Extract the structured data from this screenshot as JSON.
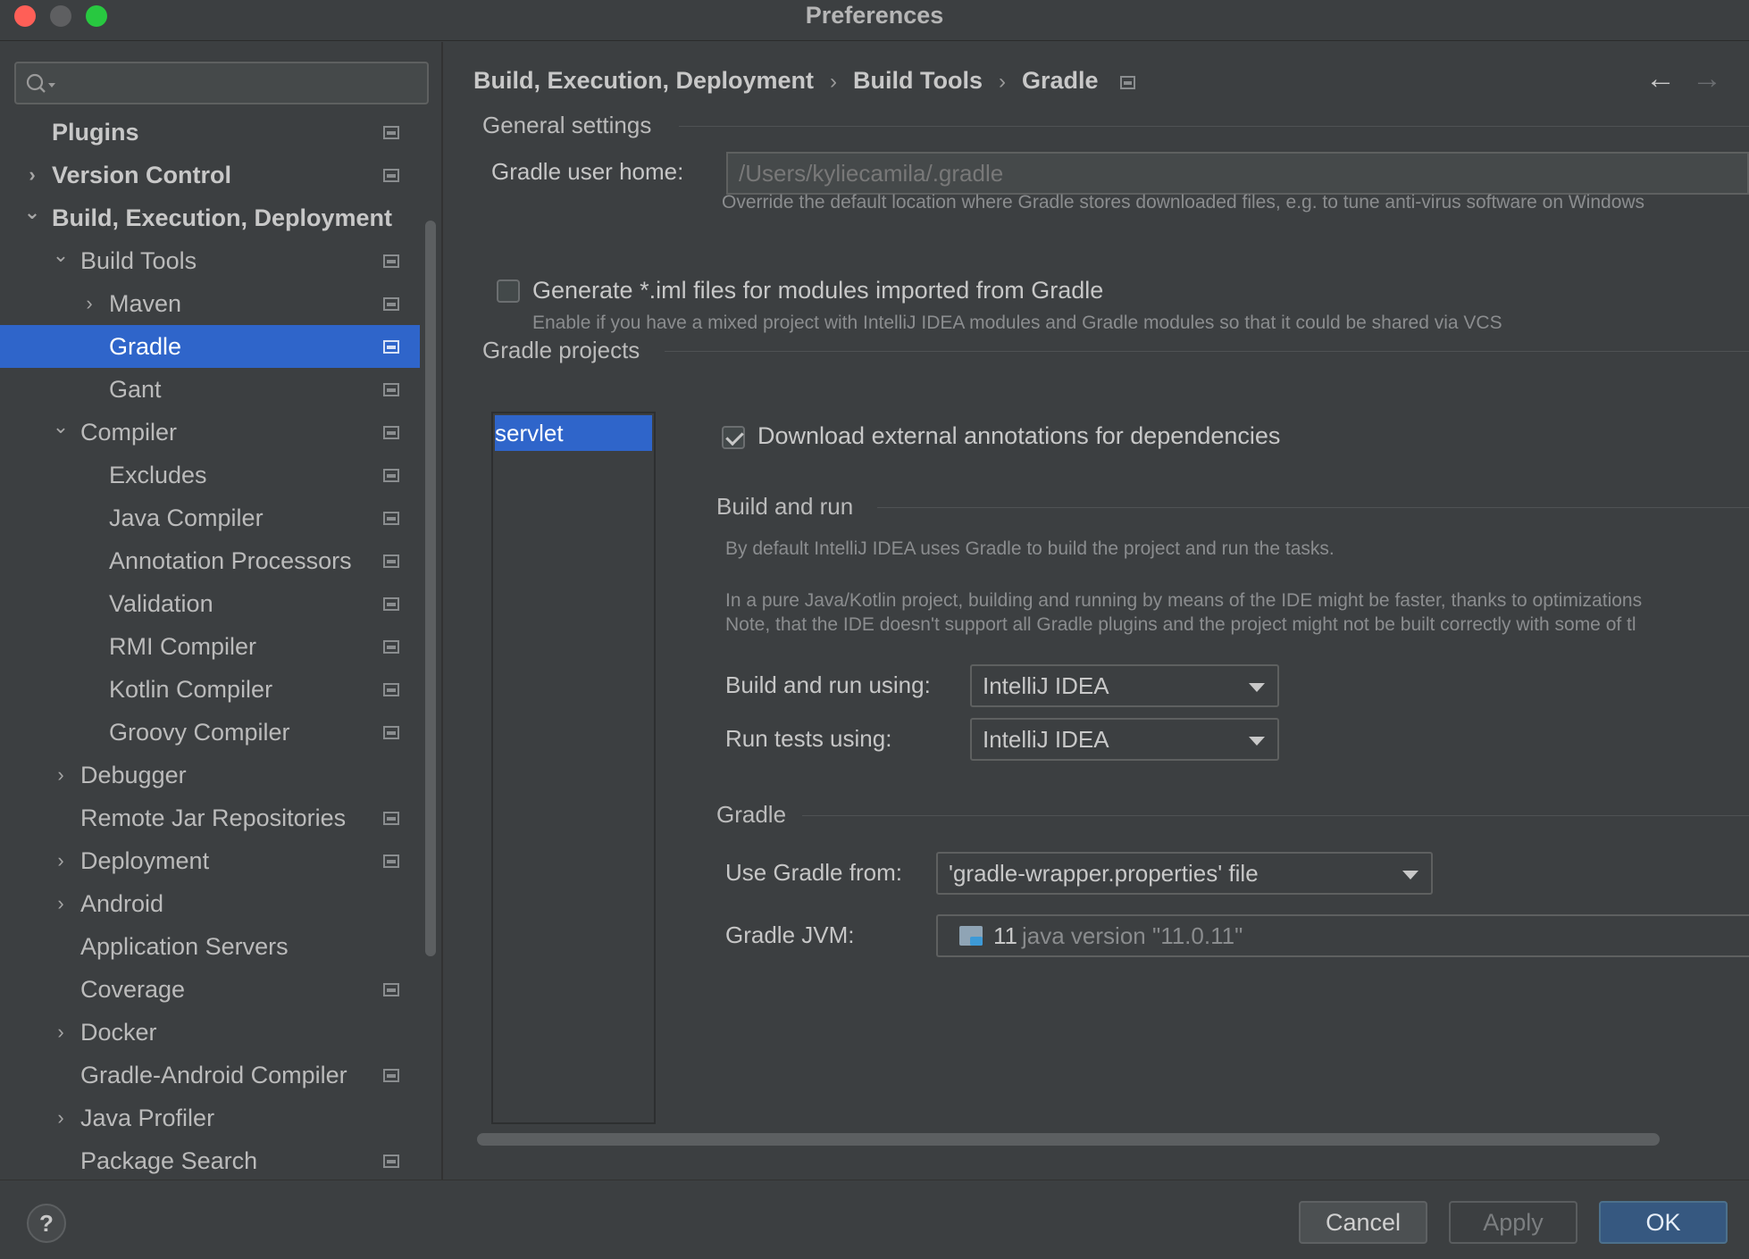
{
  "window": {
    "title": "Preferences"
  },
  "search": {
    "placeholder": ""
  },
  "sidebar": {
    "items": [
      {
        "label": "Plugins",
        "level": 0,
        "bold": true,
        "chevron": "",
        "project_icon": true,
        "selected": false
      },
      {
        "label": "Version Control",
        "level": 0,
        "bold": true,
        "chevron": "›",
        "project_icon": true,
        "selected": false
      },
      {
        "label": "Build, Execution, Deployment",
        "level": 0,
        "bold": true,
        "chevron": "⌄",
        "project_icon": false,
        "selected": false
      },
      {
        "label": "Build Tools",
        "level": 1,
        "bold": false,
        "chevron": "⌄",
        "project_icon": true,
        "selected": false
      },
      {
        "label": "Maven",
        "level": 2,
        "bold": false,
        "chevron": "›",
        "project_icon": true,
        "selected": false
      },
      {
        "label": "Gradle",
        "level": 2,
        "bold": false,
        "chevron": "",
        "project_icon": true,
        "selected": true
      },
      {
        "label": "Gant",
        "level": 2,
        "bold": false,
        "chevron": "",
        "project_icon": true,
        "selected": false
      },
      {
        "label": "Compiler",
        "level": 1,
        "bold": false,
        "chevron": "⌄",
        "project_icon": true,
        "selected": false
      },
      {
        "label": "Excludes",
        "level": 2,
        "bold": false,
        "chevron": "",
        "project_icon": true,
        "selected": false
      },
      {
        "label": "Java Compiler",
        "level": 2,
        "bold": false,
        "chevron": "",
        "project_icon": true,
        "selected": false
      },
      {
        "label": "Annotation Processors",
        "level": 2,
        "bold": false,
        "chevron": "",
        "project_icon": true,
        "selected": false
      },
      {
        "label": "Validation",
        "level": 2,
        "bold": false,
        "chevron": "",
        "project_icon": true,
        "selected": false
      },
      {
        "label": "RMI Compiler",
        "level": 2,
        "bold": false,
        "chevron": "",
        "project_icon": true,
        "selected": false
      },
      {
        "label": "Kotlin Compiler",
        "level": 2,
        "bold": false,
        "chevron": "",
        "project_icon": true,
        "selected": false
      },
      {
        "label": "Groovy Compiler",
        "level": 2,
        "bold": false,
        "chevron": "",
        "project_icon": true,
        "selected": false
      },
      {
        "label": "Debugger",
        "level": 1,
        "bold": false,
        "chevron": "›",
        "project_icon": false,
        "selected": false
      },
      {
        "label": "Remote Jar Repositories",
        "level": 1,
        "bold": false,
        "chevron": "",
        "project_icon": true,
        "selected": false
      },
      {
        "label": "Deployment",
        "level": 1,
        "bold": false,
        "chevron": "›",
        "project_icon": true,
        "selected": false
      },
      {
        "label": "Android",
        "level": 1,
        "bold": false,
        "chevron": "›",
        "project_icon": false,
        "selected": false
      },
      {
        "label": "Application Servers",
        "level": 1,
        "bold": false,
        "chevron": "",
        "project_icon": false,
        "selected": false
      },
      {
        "label": "Coverage",
        "level": 1,
        "bold": false,
        "chevron": "",
        "project_icon": true,
        "selected": false
      },
      {
        "label": "Docker",
        "level": 1,
        "bold": false,
        "chevron": "›",
        "project_icon": false,
        "selected": false
      },
      {
        "label": "Gradle-Android Compiler",
        "level": 1,
        "bold": false,
        "chevron": "",
        "project_icon": true,
        "selected": false
      },
      {
        "label": "Java Profiler",
        "level": 1,
        "bold": false,
        "chevron": "›",
        "project_icon": false,
        "selected": false
      },
      {
        "label": "Package Search",
        "level": 1,
        "bold": false,
        "chevron": "",
        "project_icon": true,
        "selected": false
      }
    ]
  },
  "breadcrumb": {
    "items": [
      "Build, Execution, Deployment",
      "Build Tools",
      "Gradle"
    ],
    "separator": "›",
    "back_icon": "arrow-left-icon",
    "forward_icon": "arrow-right-icon"
  },
  "general": {
    "title": "General settings",
    "user_home_label": "Gradle user home:",
    "user_home_value": "/Users/kyliecamila/.gradle",
    "user_home_hint": "Override the default location where Gradle stores downloaded files, e.g. to tune anti-virus software on Windows",
    "iml_label": "Generate *.iml files for modules imported from Gradle",
    "iml_checked": false,
    "iml_hint": "Enable if you have a mixed project with IntelliJ IDEA modules and Gradle modules so that it could be shared via VCS"
  },
  "projects": {
    "title": "Gradle projects",
    "list": [
      "servlet"
    ],
    "download_label": "Download external annotations for dependencies",
    "download_checked": true
  },
  "build_run": {
    "title": "Build and run",
    "desc1": "By default IntelliJ IDEA uses Gradle to build the project and run the tasks.",
    "desc2": "In a pure Java/Kotlin project, building and running by means of the IDE might be faster, thanks to optimizations",
    "desc3": "Note, that the IDE doesn't support all Gradle plugins and the project might not be built correctly with some of tl",
    "build_label": "Build and run using:",
    "build_value": "IntelliJ IDEA",
    "tests_label": "Run tests using:",
    "tests_value": "IntelliJ IDEA"
  },
  "gradle": {
    "title": "Gradle",
    "use_from_label": "Use Gradle from:",
    "use_from_value": "'gradle-wrapper.properties' file",
    "jvm_label": "Gradle JVM:",
    "jvm_version": "11",
    "jvm_desc": "java version \"11.0.11\"",
    "jvm_icon": "java-folder-icon"
  },
  "footer": {
    "help": "?",
    "cancel": "Cancel",
    "apply": "Apply",
    "ok": "OK"
  },
  "colors": {
    "background": "#3c3f41",
    "selection": "#2f65ca",
    "ok_button": "#365880",
    "close": "#ff5f57",
    "maximize": "#28c840"
  }
}
